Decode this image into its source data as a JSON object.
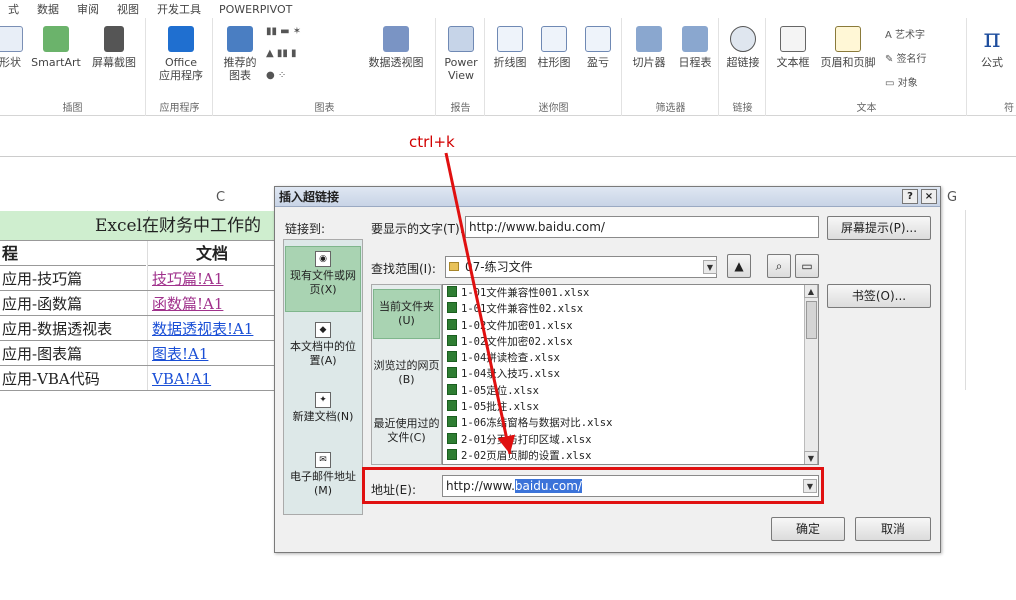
{
  "tabs": [
    "式",
    "数据",
    "审阅",
    "视图",
    "开发工具",
    "POWERPIVOT"
  ],
  "ribbon": {
    "groups": [
      {
        "label": "插图",
        "buttons": [
          "形状",
          "SmartArt",
          "屏幕截图"
        ]
      },
      {
        "label": "应用程序",
        "buttons": [
          "Office",
          "应用程序"
        ]
      },
      {
        "label": "图表",
        "buttons": [
          "推荐的",
          "图表",
          "数据透视图"
        ]
      },
      {
        "label": "报告",
        "buttons": [
          "Power",
          "View"
        ]
      },
      {
        "label": "迷你图",
        "buttons": [
          "折线图",
          "柱形图",
          "盈亏"
        ]
      },
      {
        "label": "筛选器",
        "buttons": [
          "切片器",
          "日程表"
        ]
      },
      {
        "label": "链接",
        "buttons": [
          "超链接"
        ]
      },
      {
        "label": "文本",
        "buttons": [
          "文本框",
          "页眉和页脚",
          "艺术字",
          "签名行",
          "对象"
        ]
      },
      {
        "label": "符",
        "buttons": [
          "公式"
        ]
      }
    ]
  },
  "annotation": "ctrl+k",
  "sheet": {
    "col_c": "C",
    "col_g": "G",
    "title": "Excel在财务中工作的",
    "header_a": "程",
    "header_c": "文档",
    "rows": [
      {
        "a": "应用-技巧篇",
        "c": "技巧篇!A1",
        "visited": true
      },
      {
        "a": "应用-函数篇",
        "c": "函数篇!A1",
        "visited": true
      },
      {
        "a": "应用-数据透视表",
        "c": "数据透视表!A1",
        "visited": false
      },
      {
        "a": "应用-图表篇",
        "c": "图表!A1",
        "visited": false
      },
      {
        "a": "应用-VBA代码",
        "c": "VBA!A1",
        "visited": false
      }
    ]
  },
  "dialog": {
    "title": "插入超链接",
    "help": "?",
    "close": "×",
    "link_to_label": "链接到:",
    "display_text_label": "要显示的文字(T):",
    "display_text_value": "http://www.baidu.com/",
    "screentip_button": "屏幕提示(P)...",
    "lookin_label": "查找范围(I):",
    "lookin_value": "07-练习文件",
    "bookmark_button": "书签(O)...",
    "link_items": [
      {
        "label": "现有文件或网页(X)",
        "active": true
      },
      {
        "label": "本文档中的位置(A)",
        "active": false
      },
      {
        "label": "新建文档(N)",
        "active": false
      },
      {
        "label": "电子邮件地址(M)",
        "active": false
      }
    ],
    "sub_items": [
      {
        "label": "当前文件夹(U)",
        "active": true
      },
      {
        "label": "浏览过的网页(B)",
        "active": false
      },
      {
        "label": "最近使用过的文件(C)",
        "active": false
      }
    ],
    "files": [
      "1-01文件兼容性001.xlsx",
      "1-01文件兼容性02.xlsx",
      "1-02文件加密01.xlsx",
      "1-02文件加密02.xlsx",
      "1-04拼读检查.xlsx",
      "1-04录入技巧.xlsx",
      "1-05定位.xlsx",
      "1-05批注.xlsx",
      "1-06冻结窗格与数据对比.xlsx",
      "2-01分页与打印区域.xlsx",
      "2-02页眉页脚的设置.xlsx"
    ],
    "address_label": "地址(E):",
    "address_prefix": "http://www.",
    "address_selected": "baidu.com/",
    "ok_button": "确定",
    "cancel_button": "取消"
  }
}
